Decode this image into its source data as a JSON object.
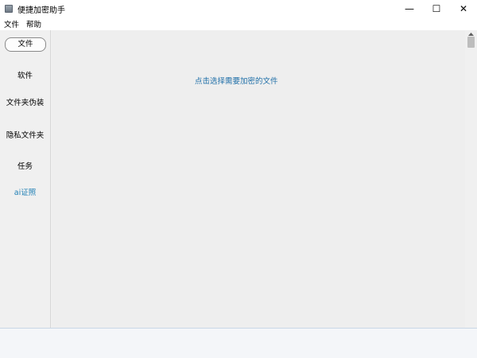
{
  "window": {
    "title": "便捷加密助手",
    "icon": "app-icon",
    "controls": {
      "minimize": "—",
      "maximize": "☐",
      "close": "✕"
    }
  },
  "menu": {
    "items": [
      {
        "label": "文件"
      },
      {
        "label": "帮助"
      }
    ]
  },
  "sidebar": {
    "items": [
      {
        "label": "文件",
        "active": true
      },
      {
        "label": "软件"
      },
      {
        "label": "文件夹伪装"
      },
      {
        "label": "隐私文件夹"
      },
      {
        "label": "任务"
      },
      {
        "label": "ai证照",
        "color": "#1f7fb5"
      }
    ]
  },
  "main": {
    "prompt": "点击选择需要加密的文件"
  },
  "colors": {
    "accent": "#1f7fb5",
    "link": "#1f6fa8"
  }
}
